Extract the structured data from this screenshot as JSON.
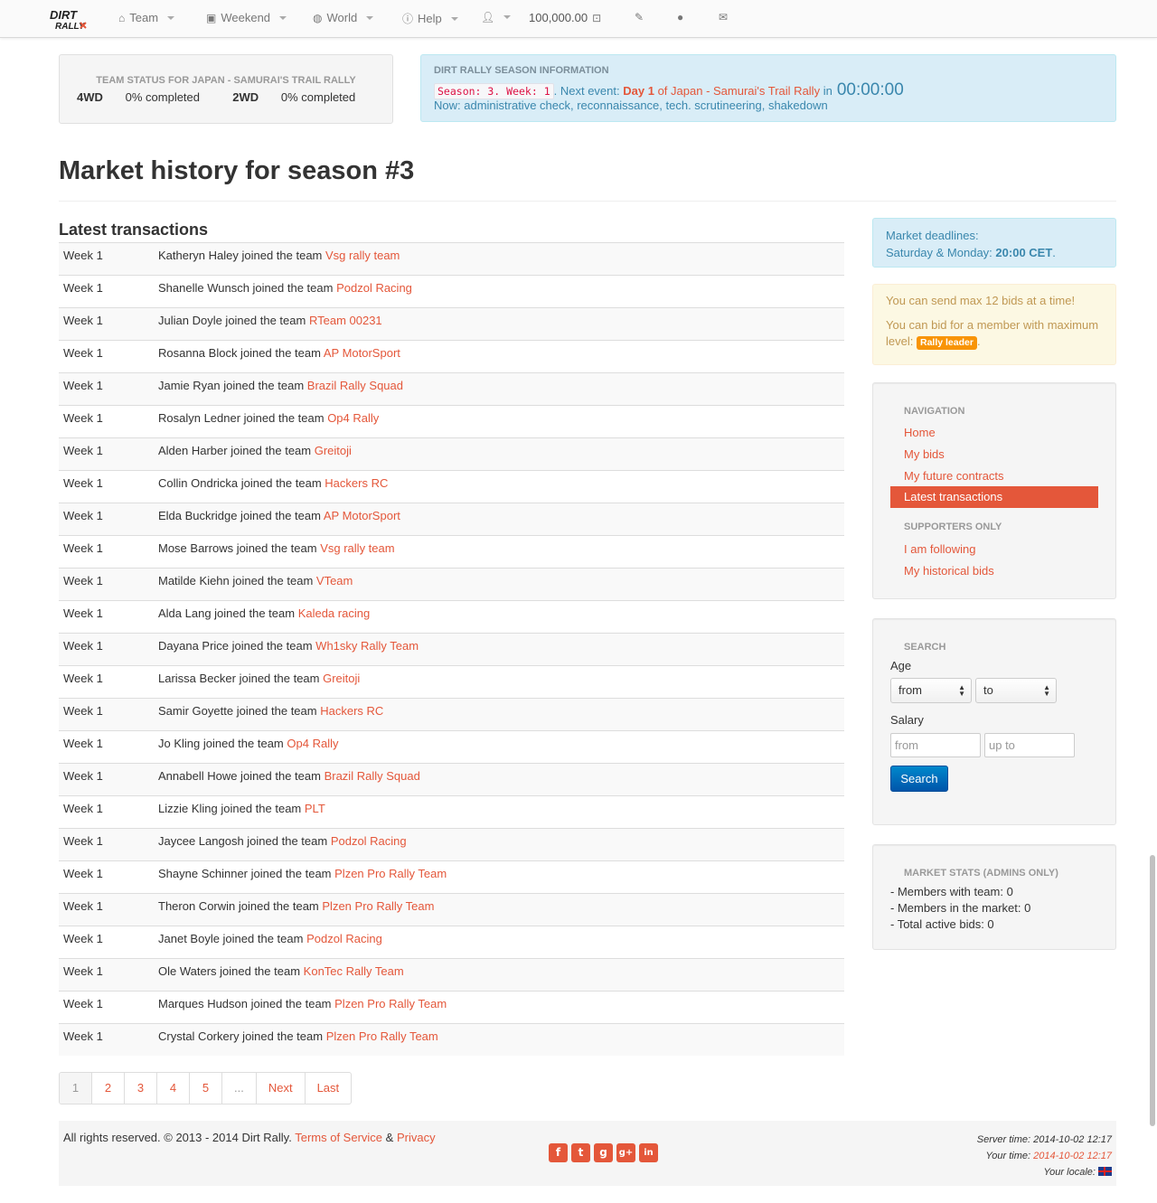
{
  "navbar": {
    "logo_text": "DIRT RALLY",
    "items": [
      {
        "label": "Team",
        "icon": "home-icon"
      },
      {
        "label": "Weekend",
        "icon": "picture-icon"
      },
      {
        "label": "World",
        "icon": "globe-icon"
      },
      {
        "label": "Help",
        "icon": "info-icon"
      }
    ],
    "user_icon": "user-icon",
    "money": "100,000.00",
    "money_icon": "money-icon",
    "edit_icon": "edit-icon",
    "globe_icon": "globe-icon",
    "mail_icon": "mail-icon"
  },
  "team_status": {
    "title": "TEAM STATUS FOR JAPAN - SAMURAI'S TRAIL RALLY",
    "fourwd_label": "4WD",
    "fourwd_value": "0% completed",
    "twowd_label": "2WD",
    "twowd_value": "0% completed"
  },
  "season_info": {
    "title": "DIRT RALLY SEASON INFORMATION",
    "code": "Season: 3. Week: 1",
    "next_event_label": ". Next event:",
    "day": "Day 1",
    "of": "of",
    "event": "Japan - Samurai's Trail Rally",
    "in": "in",
    "countdown": "00:00:00",
    "now": "Now: administrative check, reconnaissance, tech. scrutineering, shakedown"
  },
  "page_title": "Market history for season #3",
  "section_title": "Latest transactions",
  "transactions": [
    {
      "week": "Week 1",
      "text": "Katheryn Haley joined the team",
      "team": "Vsg rally team"
    },
    {
      "week": "Week 1",
      "text": "Shanelle Wunsch joined the team",
      "team": "Podzol Racing"
    },
    {
      "week": "Week 1",
      "text": "Julian Doyle joined the team",
      "team": "RTeam 00231"
    },
    {
      "week": "Week 1",
      "text": "Rosanna Block joined the team",
      "team": "AP MotorSport"
    },
    {
      "week": "Week 1",
      "text": "Jamie Ryan joined the team",
      "team": "Brazil Rally Squad"
    },
    {
      "week": "Week 1",
      "text": "Rosalyn Ledner joined the team",
      "team": "Op4 Rally"
    },
    {
      "week": "Week 1",
      "text": "Alden Harber joined the team",
      "team": "Greitoji"
    },
    {
      "week": "Week 1",
      "text": "Collin Ondricka joined the team",
      "team": "Hackers RC"
    },
    {
      "week": "Week 1",
      "text": "Elda Buckridge joined the team",
      "team": "AP MotorSport"
    },
    {
      "week": "Week 1",
      "text": "Mose Barrows joined the team",
      "team": "Vsg rally team"
    },
    {
      "week": "Week 1",
      "text": "Matilde Kiehn joined the team",
      "team": "VTeam"
    },
    {
      "week": "Week 1",
      "text": "Alda Lang joined the team",
      "team": "Kaleda racing"
    },
    {
      "week": "Week 1",
      "text": "Dayana Price joined the team",
      "team": "Wh1sky Rally Team"
    },
    {
      "week": "Week 1",
      "text": "Larissa Becker joined the team",
      "team": "Greitoji"
    },
    {
      "week": "Week 1",
      "text": "Samir Goyette joined the team",
      "team": "Hackers RC"
    },
    {
      "week": "Week 1",
      "text": "Jo Kling joined the team",
      "team": "Op4 Rally"
    },
    {
      "week": "Week 1",
      "text": "Annabell Howe joined the team",
      "team": "Brazil Rally Squad"
    },
    {
      "week": "Week 1",
      "text": "Lizzie Kling joined the team",
      "team": "PLT"
    },
    {
      "week": "Week 1",
      "text": "Jaycee Langosh joined the team",
      "team": "Podzol Racing"
    },
    {
      "week": "Week 1",
      "text": "Shayne Schinner joined the team",
      "team": "Plzen Pro Rally Team"
    },
    {
      "week": "Week 1",
      "text": "Theron Corwin joined the team",
      "team": "Plzen Pro Rally Team"
    },
    {
      "week": "Week 1",
      "text": "Janet Boyle joined the team",
      "team": "Podzol Racing"
    },
    {
      "week": "Week 1",
      "text": "Ole Waters joined the team",
      "team": "KonTec Rally Team"
    },
    {
      "week": "Week 1",
      "text": "Marques Hudson joined the team",
      "team": "Plzen Pro Rally Team"
    },
    {
      "week": "Week 1",
      "text": "Crystal Corkery joined the team",
      "team": "Plzen Pro Rally Team"
    }
  ],
  "pagination": {
    "pages": [
      "1",
      "2",
      "3",
      "4",
      "5"
    ],
    "ellipsis": "...",
    "next": "Next",
    "last": "Last"
  },
  "deadlines": {
    "line1": "Market deadlines:",
    "days": "Saturday & Monday:",
    "time": "20:00 CET",
    "period": "."
  },
  "bids_notice": {
    "line1": "You can send max 12 bids at a time!",
    "line2": "You can bid for a member with maximum level:",
    "badge": "Rally leader",
    "period": "."
  },
  "navigation": {
    "heading": "NAVIGATION",
    "items": [
      "Home",
      "My bids",
      "My future contracts"
    ],
    "active": "Latest transactions",
    "supporters_heading": "SUPPORTERS ONLY",
    "supporters_items": [
      "I am following",
      "My historical bids"
    ]
  },
  "search": {
    "heading": "SEARCH",
    "age_label": "Age",
    "age_from": "from",
    "age_to": "to",
    "salary_label": "Salary",
    "salary_from_placeholder": "from",
    "salary_to_placeholder": "up to",
    "button": "Search"
  },
  "stats": {
    "heading": "MARKET STATS (ADMINS ONLY)",
    "lines": [
      "- Members with team: 0",
      "- Members in the market: 0",
      "- Total active bids: 0"
    ]
  },
  "footer": {
    "rights": "All rights reserved. © 2013 - 2014 Dirt Rally.",
    "tos": "Terms of Service",
    "amp": "&",
    "privacy": "Privacy",
    "server_label": "Server time:",
    "server_time": "2014-10-02 12:17",
    "your_label": "Your time:",
    "your_time": "2014-10-02 12:17",
    "locale_label": "Your locale:",
    "socials": [
      "facebook-icon",
      "twitter-icon",
      "github-icon",
      "google-plus-icon",
      "linkedin-icon"
    ],
    "social_glyphs": [
      "f",
      "t",
      "g",
      "g+",
      "in"
    ]
  },
  "colors": {
    "accent": "#e4573a",
    "info": "#3a87ad",
    "warning": "#c09853",
    "badge": "#f89406",
    "primary": "#0077cc"
  }
}
